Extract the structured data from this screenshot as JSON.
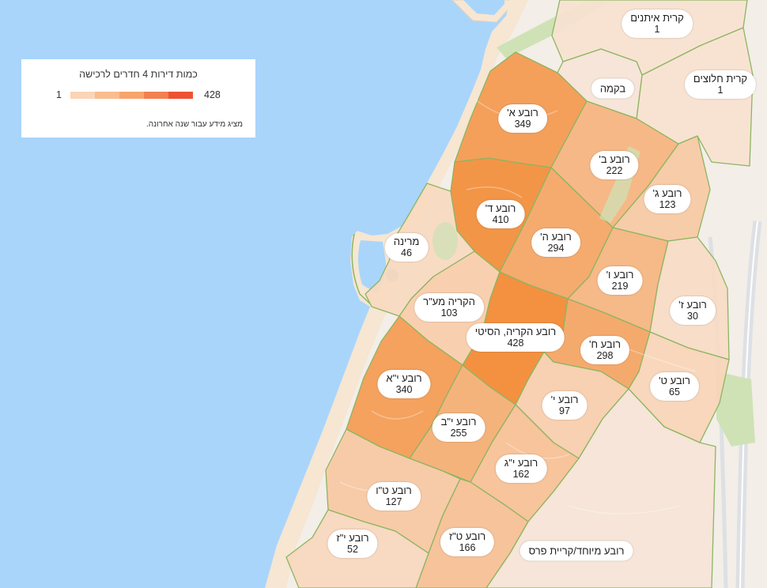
{
  "legend": {
    "title": "כמות דירות 4 חדרים לרכישה",
    "min": 1,
    "max": 428,
    "note": "מציג מידע עבור שנה אחרונה.",
    "colors": [
      "#fcd4b6",
      "#f9bc8f",
      "#f7a46d",
      "#f2814f",
      "#ee5232"
    ]
  },
  "map_fill": {
    "low": "#f8e2d0",
    "high": "#f28a33",
    "no_data": "#f5e4d6"
  },
  "colors": {
    "sea": "#a9d5fb",
    "beach": "#f6e6d2",
    "land": "#f3eee8",
    "park": "#cfe2b6",
    "road": "#dde0e4",
    "border": "#8db561",
    "pier": "#aebbc8"
  },
  "neighborhoods": [
    {
      "name": "קרית איתנים",
      "value": 1
    },
    {
      "name": "קרית חלוצים",
      "value": 1
    },
    {
      "name": "בקמה",
      "value": null
    },
    {
      "name": "רובע א'",
      "value": 349
    },
    {
      "name": "רובע ב'",
      "value": 222
    },
    {
      "name": "רובע ג'",
      "value": 123
    },
    {
      "name": "רובע ד'",
      "value": 410
    },
    {
      "name": "רובע ה'",
      "value": 294
    },
    {
      "name": "מרינה",
      "value": 46
    },
    {
      "name": "רובע ו'",
      "value": 219
    },
    {
      "name": "רובע ז'",
      "value": 30
    },
    {
      "name": "הקריה מע\"ר",
      "value": 103
    },
    {
      "name": "רובע הקריה, הסיטי",
      "value": 428
    },
    {
      "name": "רובע ח'",
      "value": 298
    },
    {
      "name": "רובע י\"א",
      "value": 340
    },
    {
      "name": "רובע ט'",
      "value": 65
    },
    {
      "name": "רובע י'",
      "value": 97
    },
    {
      "name": "רובע י\"ב",
      "value": 255
    },
    {
      "name": "רובע י\"ג",
      "value": 162
    },
    {
      "name": "רובע ט\"ו",
      "value": 127
    },
    {
      "name": "רובע ט\"ז",
      "value": 166
    },
    {
      "name": "רובע י\"ז",
      "value": 52
    },
    {
      "name": "רובע מיוחד/קריית פרס",
      "value": null
    }
  ]
}
